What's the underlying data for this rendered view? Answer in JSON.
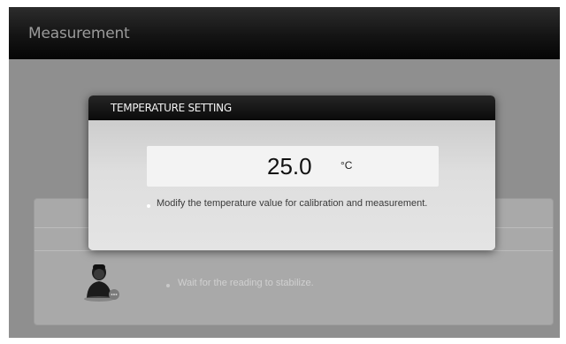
{
  "app": {
    "title": "Measurement"
  },
  "dialog": {
    "title": "TEMPERATURE SETTING",
    "value": "25.0",
    "unit": "°C",
    "hint": "Modify the temperature value for calibration and measurement."
  },
  "background": {
    "tip": "Wait for the reading to stabilize."
  },
  "icons": {
    "avatar": "operator-avatar-icon"
  },
  "colors": {
    "titlebar": "#141414",
    "overlay": "#8f8f8f",
    "dialog_header": "#0a0a0a"
  }
}
